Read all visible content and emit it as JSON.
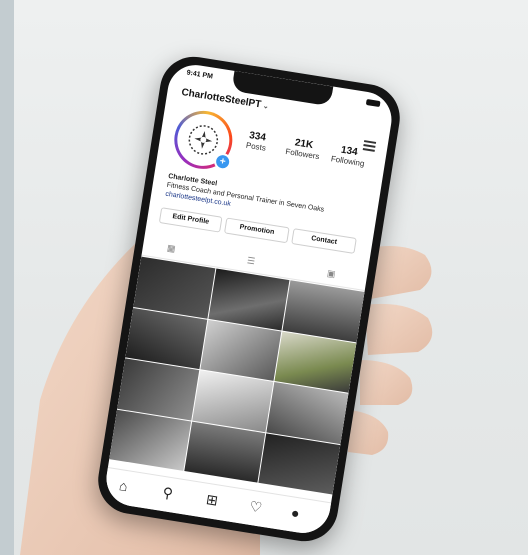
{
  "status": {
    "time": "9:41 PM"
  },
  "profile": {
    "username": "CharlotteSteelPT",
    "username_chevron": "⌄",
    "posts_count": "334",
    "posts_label": "Posts",
    "followers_count": "21K",
    "followers_label": "Followers",
    "following_count": "134",
    "following_label": "Following",
    "name": "Charlotte Steel",
    "bio_line": "Fitness Coach and Personal Trainer in Seven Oaks",
    "website": "charlottesteelpt.co.uk"
  },
  "buttons": {
    "edit_profile": "Edit Profile",
    "promotions": "Promotion",
    "contact": "Contact"
  },
  "icons": {
    "grid_tab": "grid-icon",
    "list_tab": "list-icon",
    "tagged_tab": "tagged-icon",
    "home": "home-icon",
    "search": "search-icon",
    "add": "add-icon",
    "heart": "heart-icon",
    "profile": "profile-icon"
  },
  "colors": {
    "accent_blue": "#3897f0",
    "link_blue": "#1e3a8a"
  }
}
